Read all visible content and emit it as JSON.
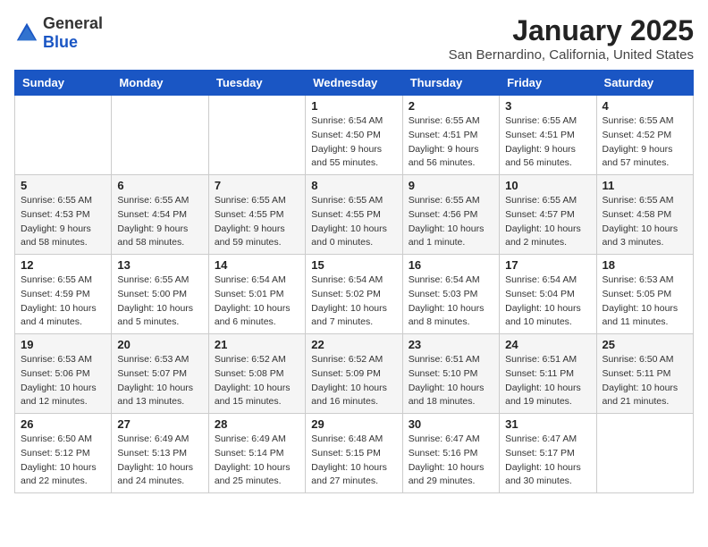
{
  "header": {
    "logo": {
      "text_general": "General",
      "text_blue": "Blue"
    },
    "title": "January 2025",
    "subtitle": "San Bernardino, California, United States"
  },
  "days_of_week": [
    "Sunday",
    "Monday",
    "Tuesday",
    "Wednesday",
    "Thursday",
    "Friday",
    "Saturday"
  ],
  "weeks": [
    [
      {
        "day": null,
        "info": null
      },
      {
        "day": null,
        "info": null
      },
      {
        "day": null,
        "info": null
      },
      {
        "day": "1",
        "info": "Sunrise: 6:54 AM\nSunset: 4:50 PM\nDaylight: 9 hours\nand 55 minutes."
      },
      {
        "day": "2",
        "info": "Sunrise: 6:55 AM\nSunset: 4:51 PM\nDaylight: 9 hours\nand 56 minutes."
      },
      {
        "day": "3",
        "info": "Sunrise: 6:55 AM\nSunset: 4:51 PM\nDaylight: 9 hours\nand 56 minutes."
      },
      {
        "day": "4",
        "info": "Sunrise: 6:55 AM\nSunset: 4:52 PM\nDaylight: 9 hours\nand 57 minutes."
      }
    ],
    [
      {
        "day": "5",
        "info": "Sunrise: 6:55 AM\nSunset: 4:53 PM\nDaylight: 9 hours\nand 58 minutes."
      },
      {
        "day": "6",
        "info": "Sunrise: 6:55 AM\nSunset: 4:54 PM\nDaylight: 9 hours\nand 58 minutes."
      },
      {
        "day": "7",
        "info": "Sunrise: 6:55 AM\nSunset: 4:55 PM\nDaylight: 9 hours\nand 59 minutes."
      },
      {
        "day": "8",
        "info": "Sunrise: 6:55 AM\nSunset: 4:55 PM\nDaylight: 10 hours\nand 0 minutes."
      },
      {
        "day": "9",
        "info": "Sunrise: 6:55 AM\nSunset: 4:56 PM\nDaylight: 10 hours\nand 1 minute."
      },
      {
        "day": "10",
        "info": "Sunrise: 6:55 AM\nSunset: 4:57 PM\nDaylight: 10 hours\nand 2 minutes."
      },
      {
        "day": "11",
        "info": "Sunrise: 6:55 AM\nSunset: 4:58 PM\nDaylight: 10 hours\nand 3 minutes."
      }
    ],
    [
      {
        "day": "12",
        "info": "Sunrise: 6:55 AM\nSunset: 4:59 PM\nDaylight: 10 hours\nand 4 minutes."
      },
      {
        "day": "13",
        "info": "Sunrise: 6:55 AM\nSunset: 5:00 PM\nDaylight: 10 hours\nand 5 minutes."
      },
      {
        "day": "14",
        "info": "Sunrise: 6:54 AM\nSunset: 5:01 PM\nDaylight: 10 hours\nand 6 minutes."
      },
      {
        "day": "15",
        "info": "Sunrise: 6:54 AM\nSunset: 5:02 PM\nDaylight: 10 hours\nand 7 minutes."
      },
      {
        "day": "16",
        "info": "Sunrise: 6:54 AM\nSunset: 5:03 PM\nDaylight: 10 hours\nand 8 minutes."
      },
      {
        "day": "17",
        "info": "Sunrise: 6:54 AM\nSunset: 5:04 PM\nDaylight: 10 hours\nand 10 minutes."
      },
      {
        "day": "18",
        "info": "Sunrise: 6:53 AM\nSunset: 5:05 PM\nDaylight: 10 hours\nand 11 minutes."
      }
    ],
    [
      {
        "day": "19",
        "info": "Sunrise: 6:53 AM\nSunset: 5:06 PM\nDaylight: 10 hours\nand 12 minutes."
      },
      {
        "day": "20",
        "info": "Sunrise: 6:53 AM\nSunset: 5:07 PM\nDaylight: 10 hours\nand 13 minutes."
      },
      {
        "day": "21",
        "info": "Sunrise: 6:52 AM\nSunset: 5:08 PM\nDaylight: 10 hours\nand 15 minutes."
      },
      {
        "day": "22",
        "info": "Sunrise: 6:52 AM\nSunset: 5:09 PM\nDaylight: 10 hours\nand 16 minutes."
      },
      {
        "day": "23",
        "info": "Sunrise: 6:51 AM\nSunset: 5:10 PM\nDaylight: 10 hours\nand 18 minutes."
      },
      {
        "day": "24",
        "info": "Sunrise: 6:51 AM\nSunset: 5:11 PM\nDaylight: 10 hours\nand 19 minutes."
      },
      {
        "day": "25",
        "info": "Sunrise: 6:50 AM\nSunset: 5:11 PM\nDaylight: 10 hours\nand 21 minutes."
      }
    ],
    [
      {
        "day": "26",
        "info": "Sunrise: 6:50 AM\nSunset: 5:12 PM\nDaylight: 10 hours\nand 22 minutes."
      },
      {
        "day": "27",
        "info": "Sunrise: 6:49 AM\nSunset: 5:13 PM\nDaylight: 10 hours\nand 24 minutes."
      },
      {
        "day": "28",
        "info": "Sunrise: 6:49 AM\nSunset: 5:14 PM\nDaylight: 10 hours\nand 25 minutes."
      },
      {
        "day": "29",
        "info": "Sunrise: 6:48 AM\nSunset: 5:15 PM\nDaylight: 10 hours\nand 27 minutes."
      },
      {
        "day": "30",
        "info": "Sunrise: 6:47 AM\nSunset: 5:16 PM\nDaylight: 10 hours\nand 29 minutes."
      },
      {
        "day": "31",
        "info": "Sunrise: 6:47 AM\nSunset: 5:17 PM\nDaylight: 10 hours\nand 30 minutes."
      },
      {
        "day": null,
        "info": null
      }
    ]
  ]
}
